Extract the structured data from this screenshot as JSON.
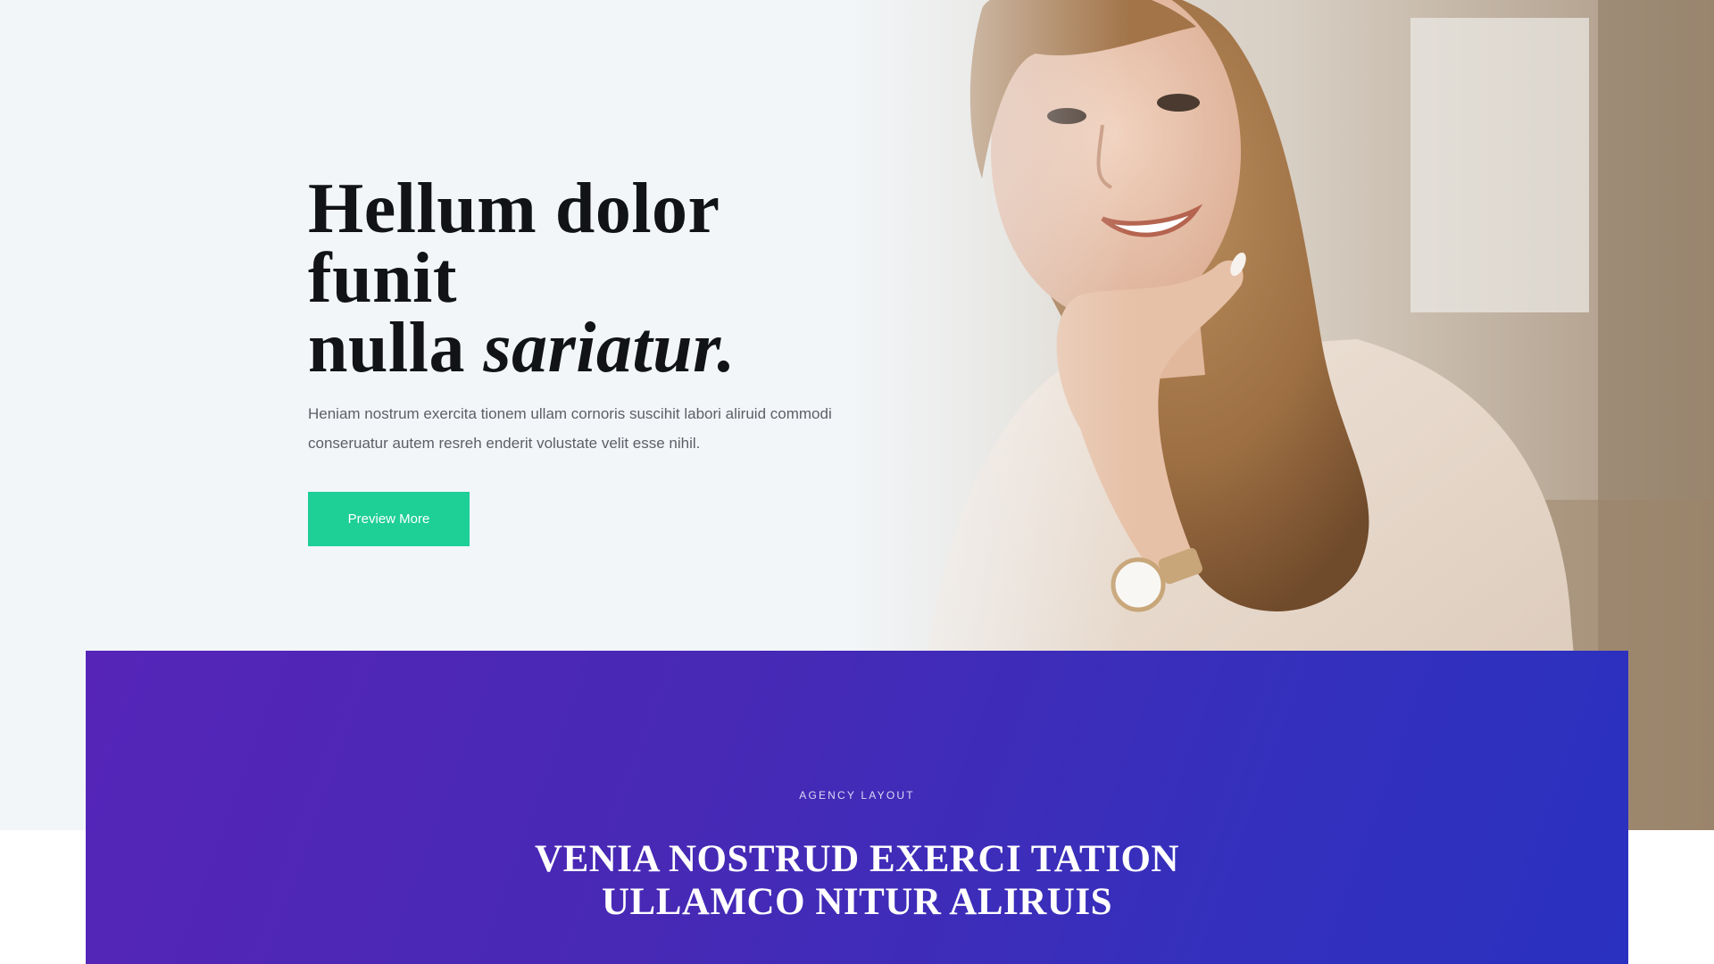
{
  "hero": {
    "title_line1_bold": "Hellum",
    "title_line1_rest": " dolor funit",
    "title_line2_plain": "nulla ",
    "title_line2_italic": "sariatur.",
    "description": "Heniam nostrum exercita tionem ullam cornoris suscihit labori aliruid commodi conseruatur autem resreh enderit volustate velit esse nihil.",
    "button_label": "Preview More",
    "button_color": "#1ecf96"
  },
  "band": {
    "eyebrow": "AGENCY LAYOUT",
    "title_line1": "VENIA NOSTRUD EXERCI TATION",
    "title_line2_plain": "ULLAMCO ",
    "title_line2_bold": "NITUR ALIRUIS",
    "gradient_start": "#5625b8",
    "gradient_end": "#2a30bf"
  }
}
